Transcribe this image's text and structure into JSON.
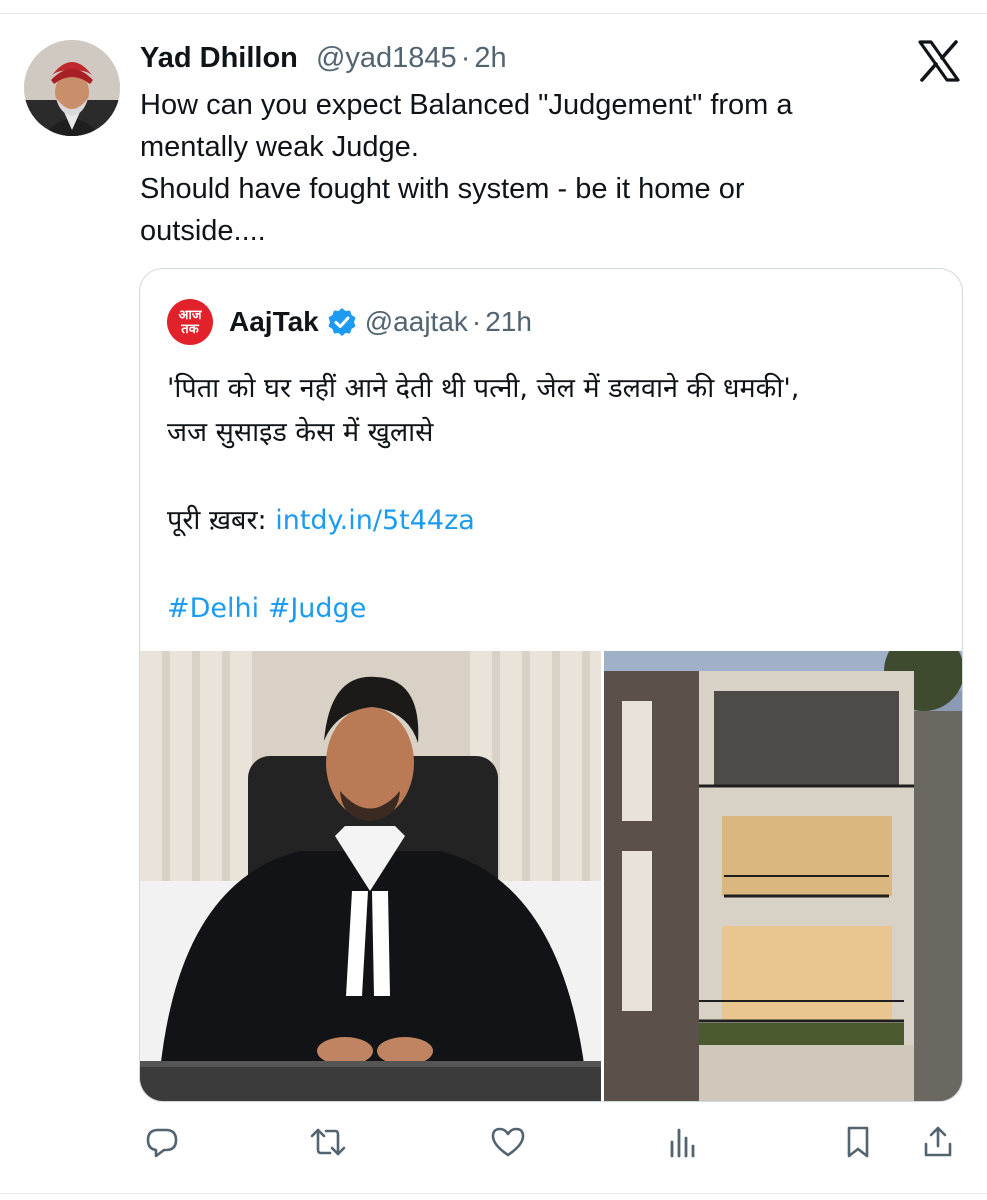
{
  "tweet": {
    "author_name": "Yad Dhillon",
    "handle": "@yad1845",
    "separator": "·",
    "time": "2h",
    "text_lines": [
      "How can you expect Balanced \"Judgement\" from a",
      "mentally weak Judge.",
      "Should have fought with system - be it home or",
      "outside...."
    ]
  },
  "quoted_tweet": {
    "author_name": "AajTak",
    "logo_text": [
      "आज",
      "तक"
    ],
    "verified": true,
    "handle": "@aajtak",
    "separator": "·",
    "time": "21h",
    "text_lines": [
      "'पिता को घर नहीं आने देती थी पत्नी, जेल में डलवाने की धमकी',",
      "जज सुसाइड केस में खुलासे"
    ],
    "link_prefix": "पूरी ख़बर:",
    "link_text": "intdy.in/5t44za",
    "hashtags": "#Delhi #Judge"
  },
  "icons": {
    "platform": "x-logo-icon",
    "reply": "reply-icon",
    "retweet": "retweet-icon",
    "like": "like-icon",
    "views": "views-icon",
    "bookmark": "bookmark-icon",
    "share": "share-icon"
  },
  "colors": {
    "text": "#0f1419",
    "secondary": "#536471",
    "link": "#1d9bf0",
    "verified": "#1d9bf0",
    "aajtak_red": "#e1222a",
    "border": "#cfd9de"
  }
}
